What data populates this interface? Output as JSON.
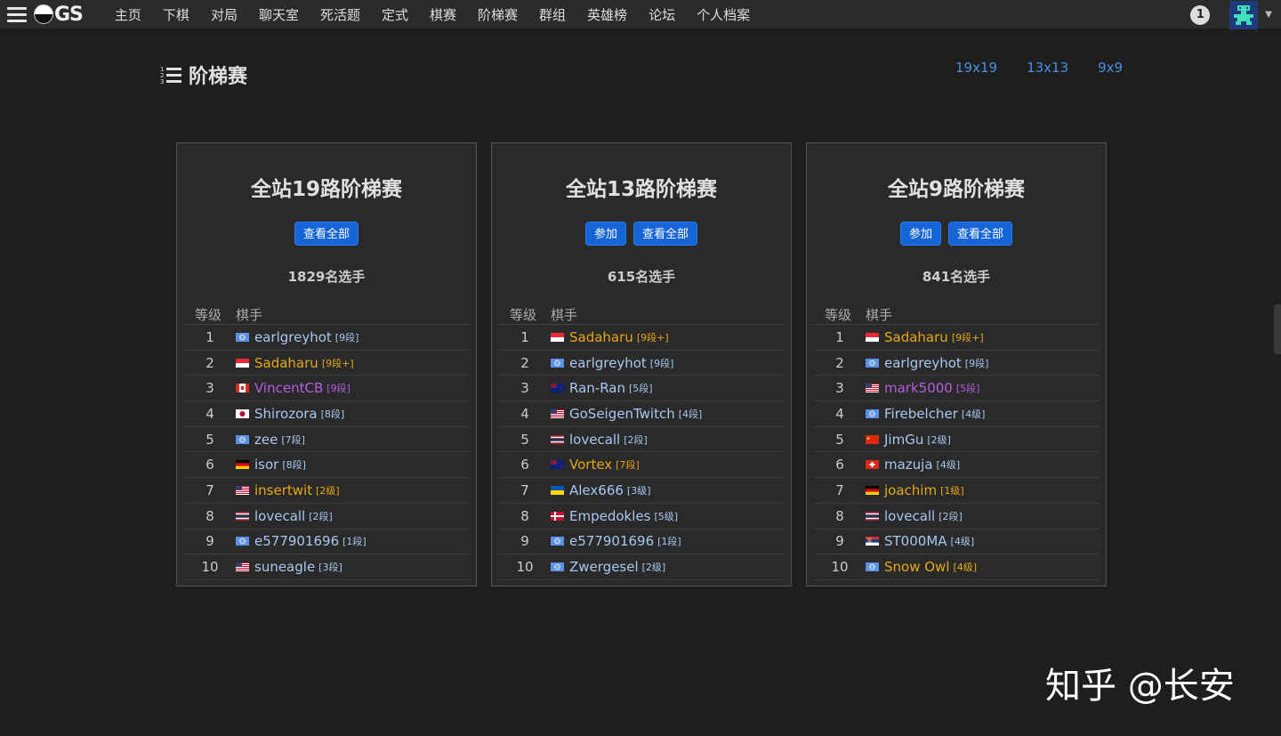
{
  "navbar": {
    "logo_text": "GS",
    "items": [
      "主页",
      "下棋",
      "对局",
      "聊天室",
      "死活题",
      "定式",
      "棋赛",
      "阶梯赛",
      "群组",
      "英雄榜",
      "论坛",
      "个人档案"
    ],
    "notification_count": "1"
  },
  "page": {
    "title": "阶梯赛",
    "size_links": [
      "19x19",
      "13x13",
      "9x9"
    ]
  },
  "ladders": [
    {
      "title": "全站19路阶梯赛",
      "buttons": [
        "查看全部"
      ],
      "player_count": "1829名选手",
      "headers": [
        "等级",
        "棋手"
      ],
      "rows": [
        {
          "rank": "1",
          "name": "earlgreyhot",
          "grade": "[9段]",
          "color": "blue",
          "flag": "un"
        },
        {
          "rank": "2",
          "name": "Sadaharu",
          "grade": "[9段+]",
          "color": "gold",
          "flag": "sg"
        },
        {
          "rank": "3",
          "name": "VincentCB",
          "grade": "[9段]",
          "color": "purple",
          "flag": "ca"
        },
        {
          "rank": "4",
          "name": "Shirozora",
          "grade": "[8段]",
          "color": "blue",
          "flag": "jp"
        },
        {
          "rank": "5",
          "name": "zee",
          "grade": "[7段]",
          "color": "blue",
          "flag": "un"
        },
        {
          "rank": "6",
          "name": "isor",
          "grade": "[8段]",
          "color": "blue",
          "flag": "de"
        },
        {
          "rank": "7",
          "name": "insertwit",
          "grade": "[2级]",
          "color": "gold",
          "flag": "us"
        },
        {
          "rank": "8",
          "name": "lovecall",
          "grade": "[2段]",
          "color": "blue",
          "flag": "th"
        },
        {
          "rank": "9",
          "name": "e577901696",
          "grade": "[1段]",
          "color": "blue",
          "flag": "un"
        },
        {
          "rank": "10",
          "name": "suneagle",
          "grade": "[3段]",
          "color": "blue",
          "flag": "us"
        }
      ]
    },
    {
      "title": "全站13路阶梯赛",
      "buttons": [
        "参加",
        "查看全部"
      ],
      "player_count": "615名选手",
      "headers": [
        "等级",
        "棋手"
      ],
      "rows": [
        {
          "rank": "1",
          "name": "Sadaharu",
          "grade": "[9段+]",
          "color": "gold",
          "flag": "sg"
        },
        {
          "rank": "2",
          "name": "earlgreyhot",
          "grade": "[9段]",
          "color": "blue",
          "flag": "un"
        },
        {
          "rank": "3",
          "name": "Ran-Ran",
          "grade": "[5段]",
          "color": "blue",
          "flag": "nz"
        },
        {
          "rank": "4",
          "name": "GoSeigenTwitch",
          "grade": "[4段]",
          "color": "blue",
          "flag": "us"
        },
        {
          "rank": "5",
          "name": "lovecall",
          "grade": "[2段]",
          "color": "blue",
          "flag": "th"
        },
        {
          "rank": "6",
          "name": "Vortex",
          "grade": "[7段]",
          "color": "gold",
          "flag": "nz"
        },
        {
          "rank": "7",
          "name": "Alex666",
          "grade": "[3级]",
          "color": "blue",
          "flag": "ua"
        },
        {
          "rank": "8",
          "name": "Empedokles",
          "grade": "[5级]",
          "color": "blue",
          "flag": "dk"
        },
        {
          "rank": "9",
          "name": "e577901696",
          "grade": "[1段]",
          "color": "blue",
          "flag": "un"
        },
        {
          "rank": "10",
          "name": "Zwergesel",
          "grade": "[2级]",
          "color": "blue",
          "flag": "un"
        }
      ]
    },
    {
      "title": "全站9路阶梯赛",
      "buttons": [
        "参加",
        "查看全部"
      ],
      "player_count": "841名选手",
      "headers": [
        "等级",
        "棋手"
      ],
      "rows": [
        {
          "rank": "1",
          "name": "Sadaharu",
          "grade": "[9段+]",
          "color": "gold",
          "flag": "sg"
        },
        {
          "rank": "2",
          "name": "earlgreyhot",
          "grade": "[9段]",
          "color": "blue",
          "flag": "un"
        },
        {
          "rank": "3",
          "name": "mark5000",
          "grade": "[5段]",
          "color": "purple",
          "flag": "us"
        },
        {
          "rank": "4",
          "name": "Firebelcher",
          "grade": "[4级]",
          "color": "blue",
          "flag": "un"
        },
        {
          "rank": "5",
          "name": "JimGu",
          "grade": "[2级]",
          "color": "blue",
          "flag": "cn"
        },
        {
          "rank": "6",
          "name": "mazuja",
          "grade": "[4级]",
          "color": "blue",
          "flag": "ch"
        },
        {
          "rank": "7",
          "name": "joachim",
          "grade": "[1级]",
          "color": "gold",
          "flag": "de"
        },
        {
          "rank": "8",
          "name": "lovecall",
          "grade": "[2段]",
          "color": "blue",
          "flag": "th"
        },
        {
          "rank": "9",
          "name": "ST000MA",
          "grade": "[4级]",
          "color": "blue",
          "flag": "rs"
        },
        {
          "rank": "10",
          "name": "Snow Owl",
          "grade": "[4级]",
          "color": "gold",
          "flag": "un"
        }
      ]
    }
  ],
  "watermark": "知乎 @长安",
  "colors": {
    "link": "#4a90e2",
    "button": "#1565d8",
    "gold": "#e6a817",
    "purple": "#b45ede",
    "player_blue": "#a8c8f0"
  }
}
